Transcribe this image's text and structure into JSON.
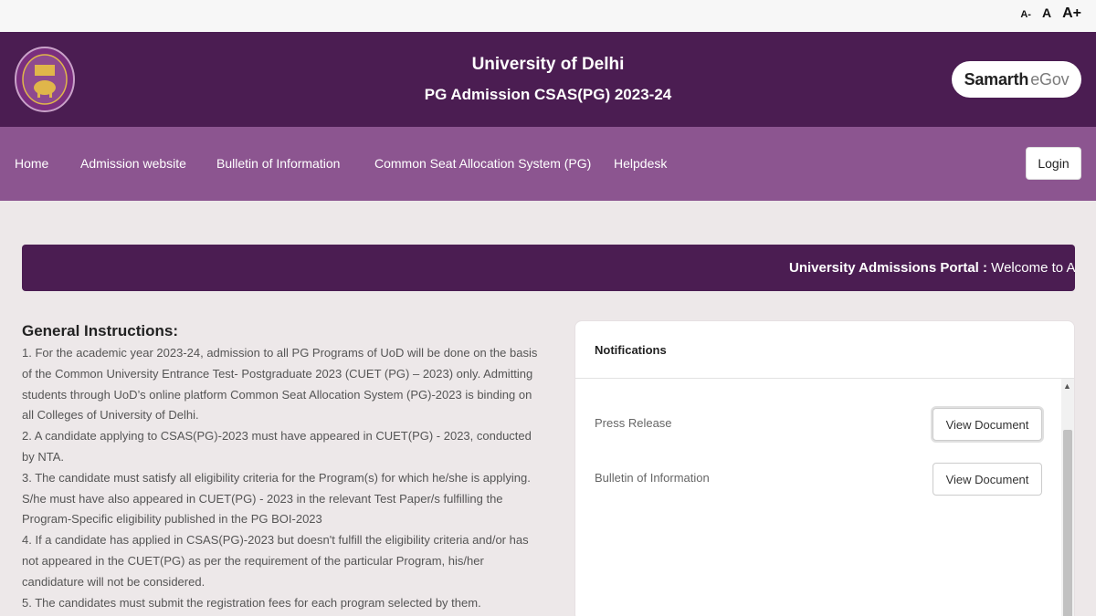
{
  "topbar": {
    "font_small": "A-",
    "font_normal": "A",
    "font_large": "A+"
  },
  "header": {
    "title": "University of Delhi",
    "subtitle": "PG Admission CSAS(PG) 2023-24",
    "brand_part1": "Samarth",
    "brand_part2": "eGov"
  },
  "nav": {
    "items": [
      "Home",
      "Admission website",
      "Bulletin of Information",
      "Common Seat Allocation System (PG)",
      "Helpdesk"
    ],
    "login_label": "Login"
  },
  "marquee": {
    "label": "University Admissions Portal :",
    "text": " Welcome to Admi"
  },
  "instructions": {
    "heading": "General Instructions:",
    "items": [
      "1. For the academic year 2023-24, admission to all PG Programs of UoD will be done on the basis of the Common University Entrance Test- Postgraduate 2023 (CUET (PG) – 2023) only. Admitting students through UoD’s online platform Common Seat Allocation System (PG)-2023 is binding on all Colleges of University of Delhi.",
      "2. A candidate applying to CSAS(PG)-2023 must have appeared in CUET(PG) - 2023, conducted by NTA.",
      "3. The candidate must satisfy all eligibility criteria for the Program(s) for which he/she is applying. S/he must have also appeared in CUET(PG) - 2023 in the relevant Test Paper/s fulfilling the Program-Specific eligibility published in the PG BOI-2023",
      "4. If a candidate has applied in CSAS(PG)-2023 but doesn't fulfill the eligibility criteria and/or has not appeared in the CUET(PG) as per the requirement of the particular Program, his/her candidature will not be considered.",
      "5. The candidates must submit the registration fees for each program selected by them."
    ]
  },
  "notifications": {
    "title": "Notifications",
    "items": [
      {
        "label": "Press Release",
        "button": "View Document"
      },
      {
        "label": "Bulletin of Information",
        "button": "View Document"
      }
    ]
  },
  "colors": {
    "header_bg": "#4b1d52",
    "nav_bg": "#8c5590",
    "page_bg": "#ede8e9"
  }
}
